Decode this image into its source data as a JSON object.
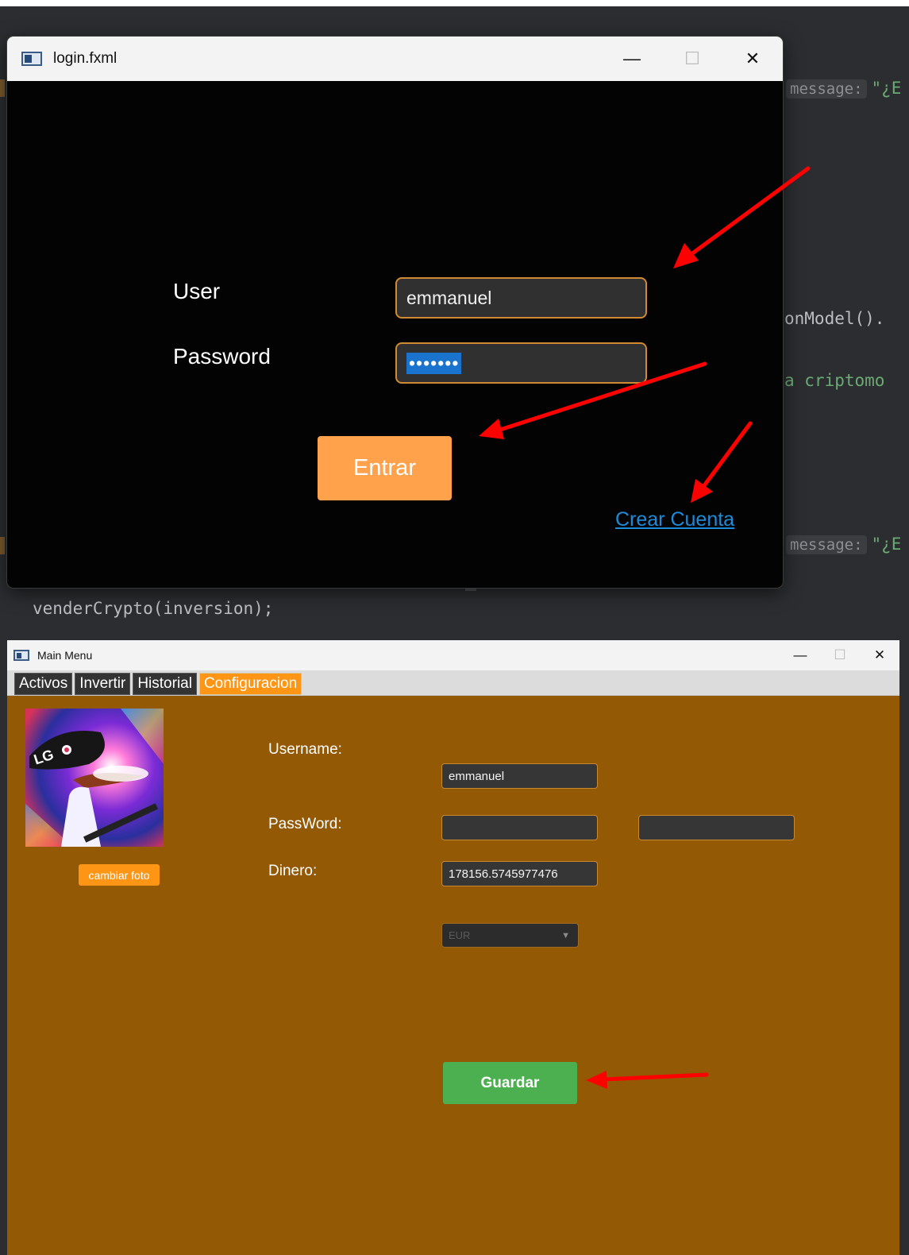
{
  "ide": {
    "line1_hint": "message:",
    "line1_str": "\"¿E",
    "line2": "onModel().",
    "line3": "a criptomo",
    "line4_hint": "message:",
    "line4_str": "\"¿E",
    "line5": "venderCrypto(inversion);"
  },
  "login_window": {
    "title": "login.fxml",
    "controls": {
      "minimize": "—",
      "maximize": "☐",
      "close": "✕"
    },
    "user_label": "User",
    "user_value": "emmanuel",
    "password_label": "Password",
    "password_value": "•••••••",
    "submit_label": "Entrar",
    "create_account_label": "Crear Cuenta"
  },
  "main_window": {
    "title": "Main Menu",
    "controls": {
      "minimize": "—",
      "maximize": "☐",
      "close": "✕"
    },
    "tabs": [
      {
        "label": "Activos",
        "active": false
      },
      {
        "label": "Invertir",
        "active": false
      },
      {
        "label": "Historial",
        "active": false
      },
      {
        "label": "Configuracion",
        "active": true
      }
    ],
    "change_photo_label": "cambiar foto",
    "avatar_text": "LG",
    "username_label": "Username:",
    "username_value": "emmanuel",
    "password_label": "PassWord:",
    "password_value": "",
    "password_confirm_value": "",
    "money_label": "Dinero:",
    "money_value": "178156.5745977476",
    "currency_selected": "EUR",
    "save_label": "Guardar"
  },
  "colors": {
    "accent_orange": "#ff9514",
    "login_button": "#ffa24b",
    "main_background": "#935905",
    "save_button": "#4caf50",
    "link": "#1d8bd8",
    "annotation_arrow": "#ff0000"
  }
}
